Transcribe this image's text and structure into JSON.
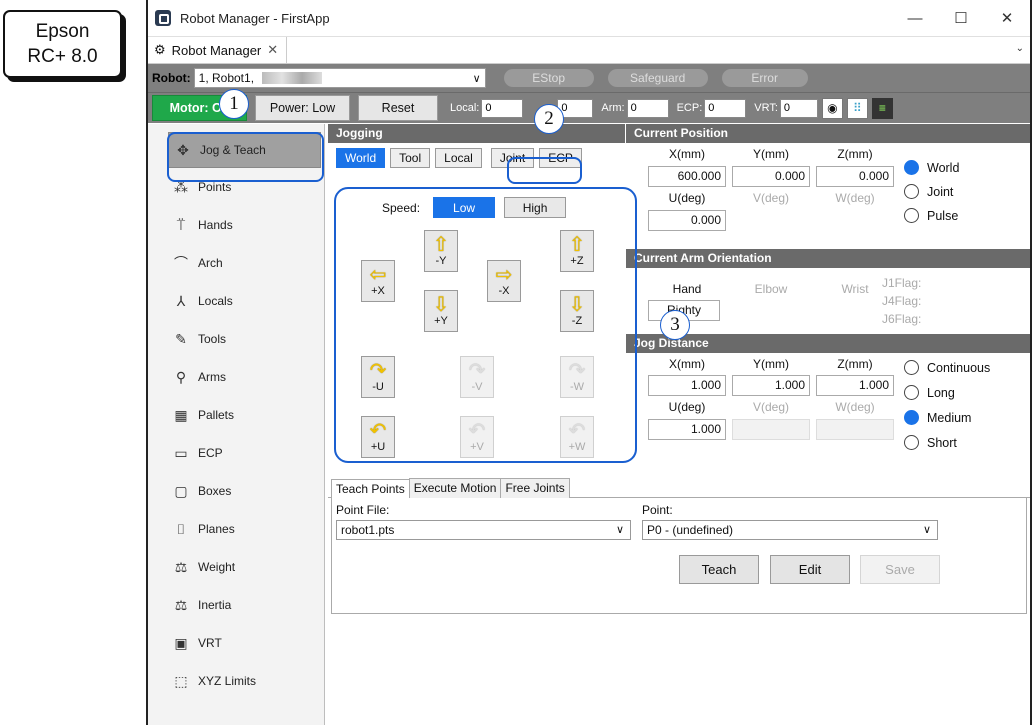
{
  "badge": {
    "line1": "Epson",
    "line2": "RC+ 8.0"
  },
  "window": {
    "title": "Robot Manager - FirstApp",
    "minimize": "—",
    "maximize": "☐",
    "close": "✕"
  },
  "doc_tab": {
    "label": "Robot Manager",
    "close": "✕",
    "overflow": "⌄"
  },
  "robot_bar": {
    "label": "Robot:",
    "selected": "1, Robot1,",
    "estop": "EStop",
    "safeguard": "Safeguard",
    "error": "Error"
  },
  "motor_bar": {
    "motor": "Motor: On",
    "power": "Power: Low",
    "reset": "Reset",
    "local_label": "Local:",
    "local_value": "0",
    "tool_value": "0",
    "arm_label": "Arm:",
    "arm_value": "0",
    "ecp_label": "ECP:",
    "ecp_value": "0",
    "vrt_label": "VRT:",
    "vrt_value": "0"
  },
  "nav": [
    {
      "label": "Jog & Teach",
      "icon": "move-icon",
      "glyph": "✥"
    },
    {
      "label": "Points",
      "icon": "points-icon",
      "glyph": "⁂"
    },
    {
      "label": "Hands",
      "icon": "hand-icon",
      "glyph": "⍡"
    },
    {
      "label": "Arch",
      "icon": "arch-icon",
      "glyph": "⌒"
    },
    {
      "label": "Locals",
      "icon": "axes-icon",
      "glyph": "⅄"
    },
    {
      "label": "Tools",
      "icon": "tool-icon",
      "glyph": "✎"
    },
    {
      "label": "Arms",
      "icon": "arm-icon",
      "glyph": "⚲"
    },
    {
      "label": "Pallets",
      "icon": "grid-icon",
      "glyph": "▦"
    },
    {
      "label": "ECP",
      "icon": "ecp-icon",
      "glyph": "▭"
    },
    {
      "label": "Boxes",
      "icon": "box-icon",
      "glyph": "▢"
    },
    {
      "label": "Planes",
      "icon": "plane-icon",
      "glyph": "⌷"
    },
    {
      "label": "Weight",
      "icon": "weight-icon",
      "glyph": "⚖"
    },
    {
      "label": "Inertia",
      "icon": "inertia-icon",
      "glyph": "⚖"
    },
    {
      "label": "VRT",
      "icon": "vrt-icon",
      "glyph": "▣"
    },
    {
      "label": "XYZ Limits",
      "icon": "limits-icon",
      "glyph": "⬚"
    }
  ],
  "jogging": {
    "header": "Jogging",
    "modes": [
      "World",
      "Tool",
      "Local",
      "Joint",
      "ECP"
    ],
    "active_mode": "World",
    "speed_label": "Speed:",
    "speed_low": "Low",
    "speed_high": "High",
    "active_speed": "Low",
    "buttons": {
      "py": "-Y",
      "mz": "+Z",
      "mx": "+X",
      "px": "-X",
      "ny": "+Y",
      "nz": "-Z",
      "u1": "-U",
      "v1": "-V",
      "w1": "-W",
      "u2": "+U",
      "v2": "+V",
      "w2": "+W"
    }
  },
  "current_position": {
    "header": "Current Position",
    "x_label": "X(mm)",
    "y_label": "Y(mm)",
    "z_label": "Z(mm)",
    "u_label": "U(deg)",
    "v_label": "V(deg)",
    "w_label": "W(deg)",
    "x": "600.000",
    "y": "0.000",
    "z": "0.000",
    "u": "0.000",
    "frames": [
      "World",
      "Joint",
      "Pulse"
    ],
    "selected_frame": "World"
  },
  "arm_orientation": {
    "header": "Current Arm Orientation",
    "hand_label": "Hand",
    "elbow_label": "Elbow",
    "wrist_label": "Wrist",
    "hand_value": "Righty",
    "j1": "J1Flag:",
    "j4": "J4Flag:",
    "j6": "J6Flag:"
  },
  "jog_distance": {
    "header": "Jog Distance",
    "x_label": "X(mm)",
    "y_label": "Y(mm)",
    "z_label": "Z(mm)",
    "u_label": "U(deg)",
    "v_label": "V(deg)",
    "w_label": "W(deg)",
    "x": "1.000",
    "y": "1.000",
    "z": "1.000",
    "u": "1.000",
    "modes": [
      "Continuous",
      "Long",
      "Medium",
      "Short"
    ],
    "selected_mode": "Medium"
  },
  "bottom_tabs": {
    "tabs": [
      "Teach Points",
      "Execute Motion",
      "Free Joints"
    ],
    "active": "Teach Points",
    "point_file_label": "Point File:",
    "point_file": "robot1.pts",
    "point_label": "Point:",
    "point": "P0 - (undefined)",
    "teach": "Teach",
    "edit": "Edit",
    "save": "Save"
  },
  "callouts": [
    "1",
    "2",
    "3"
  ],
  "colors": {
    "accent": "#1a73e8",
    "motor_on": "#1fa84a",
    "header_bg": "#6a6a6a",
    "bar_bg": "#7f7f7f",
    "callout": "#1a5fd0"
  }
}
